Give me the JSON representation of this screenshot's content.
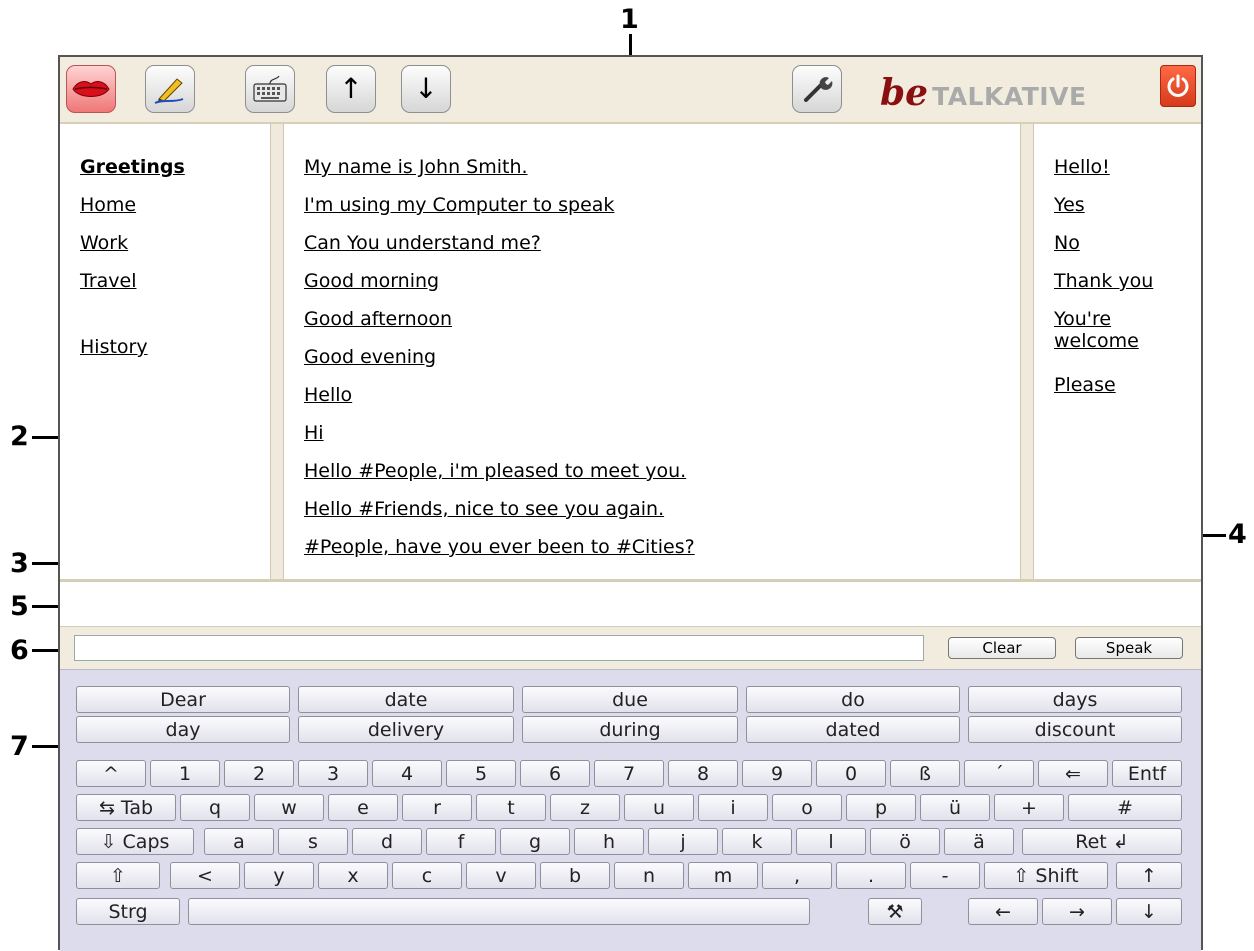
{
  "callouts": {
    "c1": "1",
    "c2": "2",
    "c3": "3",
    "c4": "4",
    "c5": "5",
    "c6": "6",
    "c7": "7"
  },
  "toolbar": {
    "speak_icon": "lips-icon",
    "edit_icon": "pen-icon",
    "keyboard_icon": "keyboard-icon",
    "up_label": "↑",
    "down_label": "↓",
    "settings_icon": "wrench-icon",
    "power_icon": "power-icon",
    "accent_color": "#8b0f10"
  },
  "logo": {
    "be": "be",
    "talkative": "TALKATIVE"
  },
  "categories": {
    "greetings": "Greetings",
    "home": "Home",
    "work": "Work",
    "travel": "Travel",
    "history": "History"
  },
  "phrases": [
    "My name is John Smith.",
    "I'm using my Computer to speak",
    "Can You understand me?",
    "Good morning",
    "Good afternoon",
    "Good evening",
    "Hello",
    "Hi",
    "Hello #People, i'm pleased to meet you.",
    "Hello #Friends, nice to see you again.",
    "#People, have you ever been to #Cities?"
  ],
  "quick": {
    "hello": "Hello!",
    "yes": "Yes",
    "no": "No",
    "thankyou": "Thank you",
    "welcome": "You're welcome",
    "please": "Please"
  },
  "input": {
    "value": "",
    "clear": "Clear",
    "speak": "Speak"
  },
  "keyboard": {
    "suggestions_row1": [
      "Dear",
      "date",
      "due",
      "do",
      "days"
    ],
    "suggestions_row2": [
      "day",
      "delivery",
      "during",
      "dated",
      "discount"
    ],
    "row1": [
      "^",
      "1",
      "2",
      "3",
      "4",
      "5",
      "6",
      "7",
      "8",
      "9",
      "0",
      "ß",
      "´",
      "⇐",
      "Entf"
    ],
    "row2": [
      "⇆ Tab",
      "q",
      "w",
      "e",
      "r",
      "t",
      "z",
      "u",
      "i",
      "o",
      "p",
      "ü",
      "+",
      "#"
    ],
    "row3": [
      "⇩ Caps",
      "a",
      "s",
      "d",
      "f",
      "g",
      "h",
      "j",
      "k",
      "l",
      "ö",
      "ä",
      "Ret ↲"
    ],
    "row4": [
      "⇧",
      "<",
      "y",
      "x",
      "c",
      "v",
      "b",
      "n",
      "m",
      ",",
      ".",
      "-",
      "⇧ Shift",
      "↑"
    ],
    "row5": [
      "Strg",
      "",
      "⚒",
      "←",
      "→",
      "↓"
    ]
  }
}
